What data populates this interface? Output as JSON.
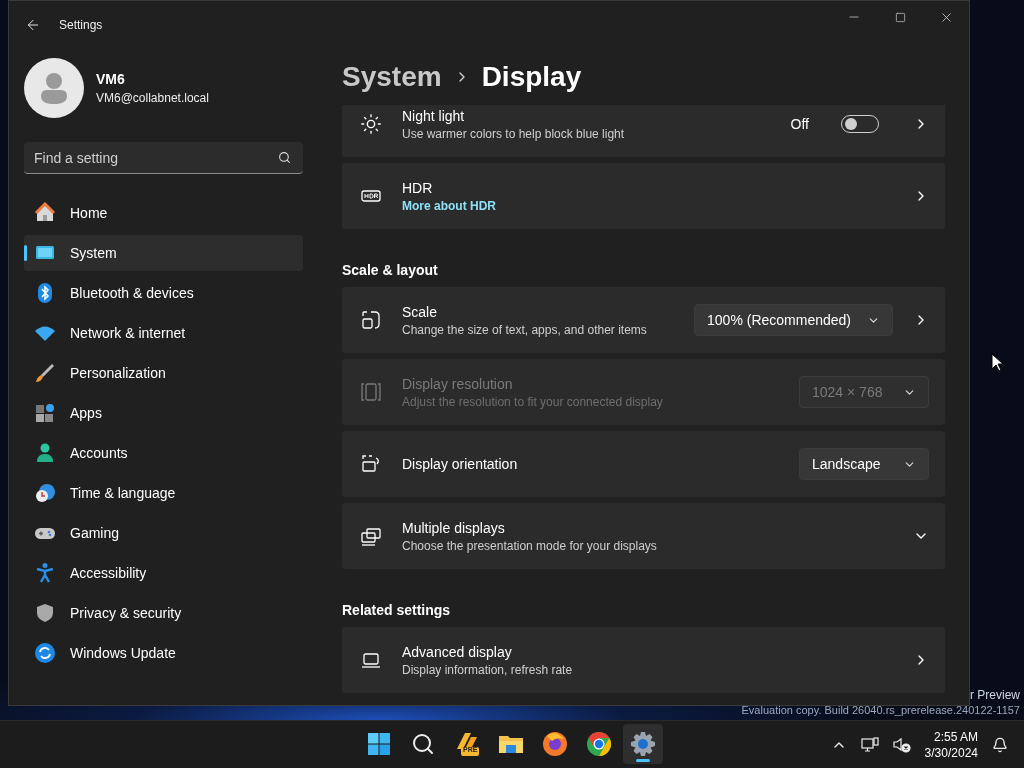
{
  "window": {
    "title": "Settings"
  },
  "account": {
    "name": "VM6",
    "email": "VM6@collabnet.local"
  },
  "search": {
    "placeholder": "Find a setting"
  },
  "nav": [
    {
      "label": "Home",
      "selected": false
    },
    {
      "label": "System",
      "selected": true
    },
    {
      "label": "Bluetooth & devices",
      "selected": false
    },
    {
      "label": "Network & internet",
      "selected": false
    },
    {
      "label": "Personalization",
      "selected": false
    },
    {
      "label": "Apps",
      "selected": false
    },
    {
      "label": "Accounts",
      "selected": false
    },
    {
      "label": "Time & language",
      "selected": false
    },
    {
      "label": "Gaming",
      "selected": false
    },
    {
      "label": "Accessibility",
      "selected": false
    },
    {
      "label": "Privacy & security",
      "selected": false
    },
    {
      "label": "Windows Update",
      "selected": false
    }
  ],
  "breadcrumb": {
    "parent": "System",
    "current": "Display"
  },
  "sections": [
    {
      "cards": [
        {
          "kind": "toggle",
          "title": "Night light",
          "subtitle": "Use warmer colors to help block blue light",
          "disabled": false,
          "toggle": {
            "label": "Off",
            "on": false
          }
        },
        {
          "kind": "link",
          "title": "HDR",
          "link": "More about HDR",
          "disabled": false
        }
      ]
    },
    {
      "heading": "Scale & layout",
      "cards": [
        {
          "kind": "dropdown",
          "title": "Scale",
          "subtitle": "Change the size of text, apps, and other items",
          "disabled": false,
          "value": "100% (Recommended)",
          "chevron": true
        },
        {
          "kind": "dropdown",
          "title": "Display resolution",
          "subtitle": "Adjust the resolution to fit your connected display",
          "disabled": true,
          "value": "1024 × 768",
          "chevron": false
        },
        {
          "kind": "dropdown",
          "title": "Display orientation",
          "disabled": false,
          "value": "Landscape",
          "chevron": false
        },
        {
          "kind": "expander",
          "title": "Multiple displays",
          "subtitle": "Choose the presentation mode for your displays",
          "disabled": false,
          "expanded": false
        }
      ]
    },
    {
      "heading": "Related settings",
      "cards": [
        {
          "kind": "link",
          "title": "Advanced display",
          "subtitle": "Display information, refresh rate",
          "disabled": false
        }
      ]
    }
  ],
  "desktop": {
    "watermark": [
      "r Preview",
      "Evaluation copy. Build 26040.rs_prerelease.240122-1157"
    ]
  },
  "taskbar": {
    "apps": [
      {
        "selected": false
      },
      {
        "selected": false
      },
      {
        "selected": false,
        "badge": "PRE"
      },
      {
        "selected": false
      },
      {
        "selected": false
      },
      {
        "selected": false
      },
      {
        "selected": true
      }
    ],
    "time": "2:55 AM",
    "date": "3/30/2024"
  }
}
